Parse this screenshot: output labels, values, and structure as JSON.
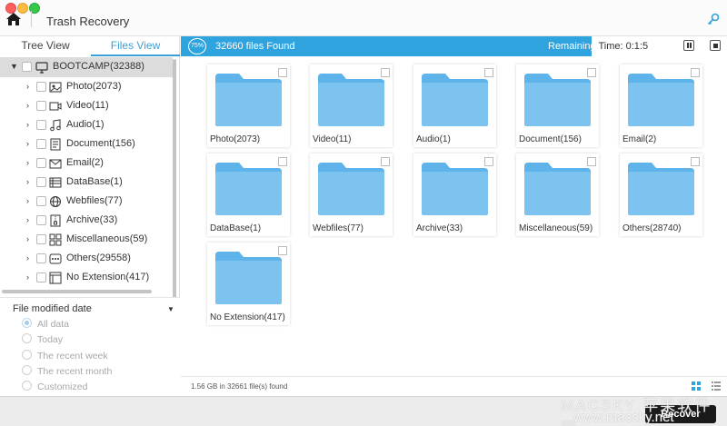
{
  "window": {
    "title": "Trash Recovery"
  },
  "tabs": {
    "tree": "Tree View",
    "files": "Files View"
  },
  "tree": {
    "root": {
      "label": "BOOTCAMP(32388)",
      "icon": "monitor-icon"
    },
    "items": [
      {
        "label": "Photo(2073)",
        "icon": "photo-icon"
      },
      {
        "label": "Video(11)",
        "icon": "video-icon"
      },
      {
        "label": "Audio(1)",
        "icon": "audio-icon"
      },
      {
        "label": "Document(156)",
        "icon": "document-icon"
      },
      {
        "label": "Email(2)",
        "icon": "email-icon"
      },
      {
        "label": "DataBase(1)",
        "icon": "database-icon"
      },
      {
        "label": "Webfiles(77)",
        "icon": "globe-icon"
      },
      {
        "label": "Archive(33)",
        "icon": "archive-icon"
      },
      {
        "label": "Miscellaneous(59)",
        "icon": "misc-icon"
      },
      {
        "label": "Others(29558)",
        "icon": "others-icon"
      },
      {
        "label": "No Extension(417)",
        "icon": "file-icon"
      }
    ]
  },
  "filter": {
    "title": "File modified date",
    "options": [
      "All data",
      "Today",
      "The recent week",
      "The recent month",
      "Customized"
    ],
    "selected": "All data"
  },
  "scan": {
    "percent_label": "75%",
    "progress": 0.75,
    "found": "32660 files Found",
    "remaining_a": "Remaining ",
    "remaining_b": "Time: 0:1:5"
  },
  "folders": [
    "Photo(2073)",
    "Video(11)",
    "Audio(1)",
    "Document(156)",
    "Email(2)",
    "DataBase(1)",
    "Webfiles(77)",
    "Archive(33)",
    "Miscellaneous(59)",
    "Others(28740)",
    "No Extension(417)"
  ],
  "status": {
    "text": "1.56 GB in 32661 file(s) found"
  },
  "actions": {
    "recover": "Recover"
  },
  "watermark": {
    "line1": "MACSKY 苹果软件园",
    "line2": "www.macsky.net"
  },
  "colors": {
    "accent": "#2ea3de",
    "folder": "#7cc3ef",
    "tab_active": "#3aa0d8"
  }
}
